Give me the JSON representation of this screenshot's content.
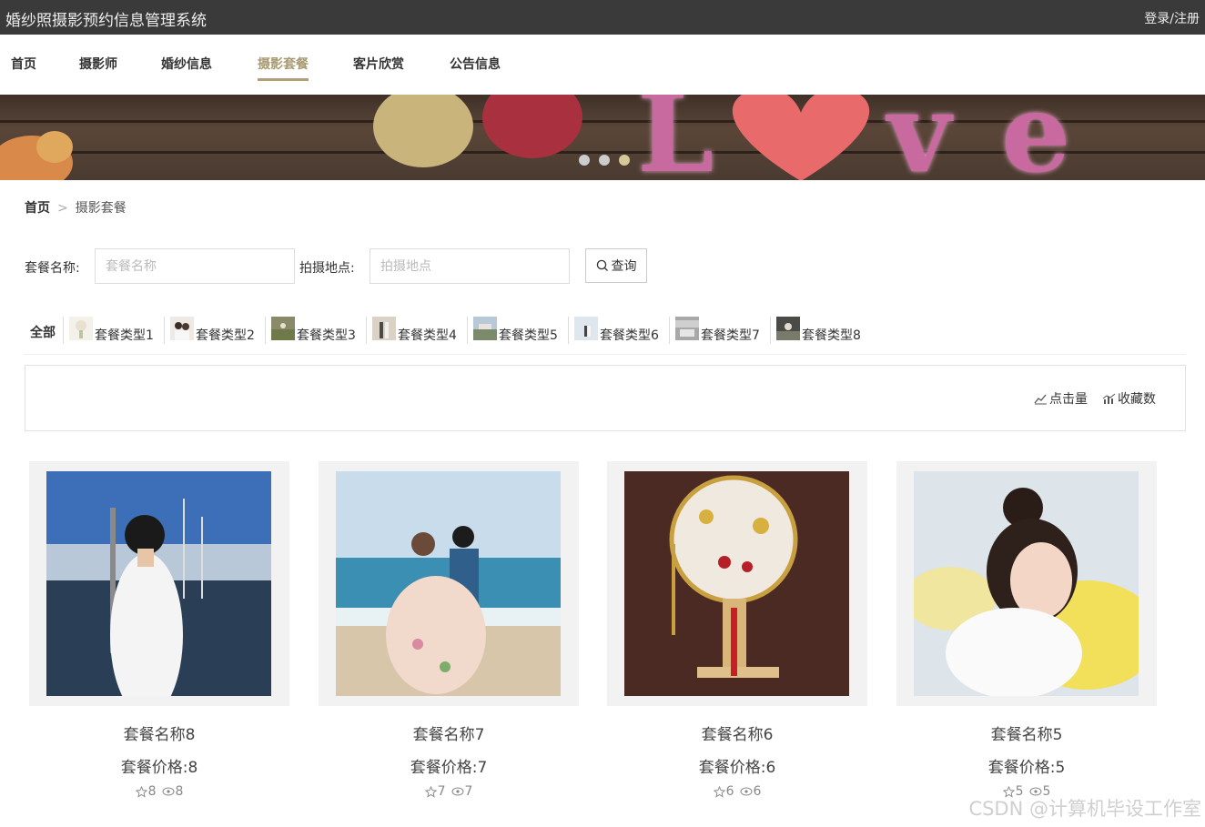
{
  "header": {
    "title": "婚纱照摄影预约信息管理系统",
    "login": "登录/注册"
  },
  "nav": {
    "items": [
      {
        "label": "首页"
      },
      {
        "label": "摄影师"
      },
      {
        "label": "婚纱信息"
      },
      {
        "label": "摄影套餐"
      },
      {
        "label": "客片欣赏"
      },
      {
        "label": "公告信息"
      }
    ],
    "active": "摄影套餐"
  },
  "banner": {
    "slide_count": 3,
    "active_slide": 3
  },
  "breadcrumb": {
    "home": "首页",
    "separator": ">",
    "current": "摄影套餐"
  },
  "search": {
    "name_label": "套餐名称:",
    "name_placeholder": "套餐名称",
    "name_value": "",
    "location_label": "拍摄地点:",
    "location_placeholder": "拍摄地点",
    "location_value": "",
    "query_button": "查询"
  },
  "categories": {
    "all_label": "全部",
    "items": [
      {
        "label": "套餐类型1"
      },
      {
        "label": "套餐类型2"
      },
      {
        "label": "套餐类型3"
      },
      {
        "label": "套餐类型4"
      },
      {
        "label": "套餐类型5"
      },
      {
        "label": "套餐类型6"
      },
      {
        "label": "套餐类型7"
      },
      {
        "label": "套餐类型8"
      }
    ]
  },
  "sort": {
    "clicks_label": "点击量",
    "favorites_label": "收藏数"
  },
  "packages": [
    {
      "name": "套餐名称8",
      "price": "套餐价格:8",
      "stars": "8",
      "views": "8"
    },
    {
      "name": "套餐名称7",
      "price": "套餐价格:7",
      "stars": "7",
      "views": "7"
    },
    {
      "name": "套餐名称6",
      "price": "套餐价格:6",
      "stars": "6",
      "views": "6"
    },
    {
      "name": "套餐名称5",
      "price": "套餐价格:5",
      "stars": "5",
      "views": "5"
    }
  ],
  "watermark": "CSDN @计算机毕设工作室",
  "colors": {
    "topbar": "#3a3a3a",
    "accent": "#b09f79",
    "banner_text": "#c86aa0"
  }
}
